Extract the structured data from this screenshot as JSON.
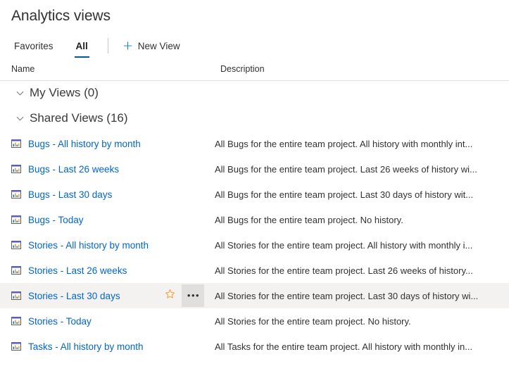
{
  "header": {
    "title": "Analytics views"
  },
  "toolbar": {
    "tabs": [
      {
        "label": "Favorites",
        "selected": false
      },
      {
        "label": "All",
        "selected": true
      }
    ],
    "new_view_label": "New View",
    "plus_icon": "plus-icon"
  },
  "columns": {
    "name": "Name",
    "description": "Description"
  },
  "groups": [
    {
      "title": "My Views (0)",
      "chevron": "chevron-down-icon",
      "rows": []
    },
    {
      "title": "Shared Views (16)",
      "chevron": "chevron-down-icon",
      "rows": [
        {
          "icon": "analytics-view-icon",
          "name": "Bugs - All history by month",
          "description": "All Bugs for the entire team project. All history with monthly int...",
          "hovered": false
        },
        {
          "icon": "analytics-view-icon",
          "name": "Bugs - Last 26 weeks",
          "description": "All Bugs for the entire team project. Last 26 weeks of history wi...",
          "hovered": false
        },
        {
          "icon": "analytics-view-icon",
          "name": "Bugs - Last 30 days",
          "description": "All Bugs for the entire team project. Last 30 days of history wit...",
          "hovered": false
        },
        {
          "icon": "analytics-view-icon",
          "name": "Bugs - Today",
          "description": "All Bugs for the entire team project. No history.",
          "hovered": false
        },
        {
          "icon": "analytics-view-icon",
          "name": "Stories - All history by month",
          "description": "All Stories for the entire team project. All history with monthly i...",
          "hovered": false
        },
        {
          "icon": "analytics-view-icon",
          "name": "Stories - Last 26 weeks",
          "description": "All Stories for the entire team project. Last 26 weeks of history...",
          "hovered": false
        },
        {
          "icon": "analytics-view-icon",
          "name": "Stories - Last 30 days",
          "description": "All Stories for the entire team project. Last 30 days of history wi...",
          "hovered": true,
          "actions": {
            "favorite_icon": "star-outline-icon",
            "more_icon": "more-actions-icon",
            "more_label": "•••"
          }
        },
        {
          "icon": "analytics-view-icon",
          "name": "Stories - Today",
          "description": "All Stories for the entire team project. No history.",
          "hovered": false
        },
        {
          "icon": "analytics-view-icon",
          "name": "Tasks - All history by month",
          "description": "All Tasks for the entire team project. All history with monthly in...",
          "hovered": false
        }
      ]
    }
  ],
  "colors": {
    "link": "#0066cc",
    "accent": "#0078d4",
    "tab_underline": "#005a9e",
    "favorite_star": "#f2a33c",
    "row_hover": "#f3f2f1",
    "more_button_bg": "#e1dfdd",
    "divider": "#e1dfdd"
  }
}
